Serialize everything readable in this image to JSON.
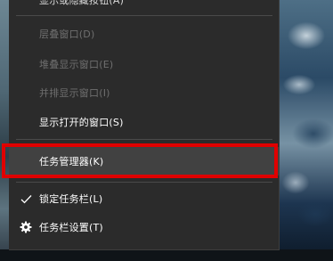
{
  "menu": {
    "items": [
      {
        "label": "显示或隐藏按钮(A)",
        "state": "clipped"
      },
      {
        "label": "层叠窗口(D)",
        "state": "disabled"
      },
      {
        "label": "堆叠显示窗口(E)",
        "state": "disabled"
      },
      {
        "label": "并排显示窗口(I)",
        "state": "disabled"
      },
      {
        "label": "显示打开的窗口(S)",
        "state": "enabled"
      },
      {
        "label": "任务管理器(K)",
        "state": "highlighted"
      },
      {
        "label": "锁定任务栏(L)",
        "state": "checked",
        "icon": "checkmark-icon"
      },
      {
        "label": "任务栏设置(T)",
        "state": "enabled",
        "icon": "gear-icon"
      }
    ]
  },
  "colors": {
    "menu_background": "#2b2b2b",
    "hover_background": "#414141",
    "disabled_text": "#6f6f6f",
    "highlight_marker": "#e00000"
  }
}
